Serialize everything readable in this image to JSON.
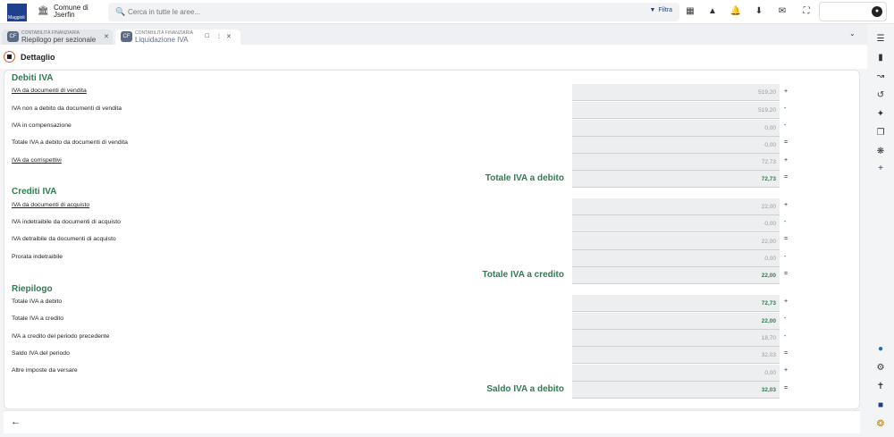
{
  "app": {
    "logo_text": "Maggioli",
    "org_name": "Comune di Jserfin",
    "search_placeholder": "Cerca in tutte le aree...",
    "filter_label": "Filtra",
    "topbar_icons": [
      "apps-icon",
      "alert-icon",
      "bell-icon",
      "download-icon",
      "mail-icon",
      "fullscreen-icon"
    ]
  },
  "tabs": [
    {
      "category": "CONTABILITÀ FINANZIARIA",
      "title": "Riepilogo per sezionale",
      "icon": "CF"
    },
    {
      "category": "CONTABILITÀ FINANZIARIA",
      "title": "Liquidazione IVA",
      "icon": "CF"
    }
  ],
  "header": {
    "title": "Dettaglio"
  },
  "debiti": {
    "title": "Debiti IVA",
    "rows": [
      {
        "label": "IVA da documenti di vendita",
        "value": "519,20",
        "op": "+"
      },
      {
        "label": "IVA non a debito da documenti di vendita",
        "value": "519,20",
        "op": "-"
      },
      {
        "label": "IVA in compensazione",
        "value": "0,00",
        "op": "-"
      },
      {
        "label": "Totale IVA a debito da documenti di vendita",
        "value": "0,00",
        "op": "="
      },
      {
        "label": "IVA da corrispettivi",
        "value": "72,73",
        "op": "+"
      }
    ],
    "total_label": "Totale IVA a debito",
    "total_value": "72,73",
    "total_op": "="
  },
  "crediti": {
    "title": "Crediti IVA",
    "rows": [
      {
        "label": "IVA da documenti di acquisto",
        "value": "22,00",
        "op": "+"
      },
      {
        "label": "IVA indetraibile da documenti di acquisto",
        "value": "0,00",
        "op": "-"
      },
      {
        "label": "IVA detraibile da documenti di acquisto",
        "value": "22,00",
        "op": "="
      },
      {
        "label": "Prorata indetraibile",
        "value": "0,00",
        "op": "-"
      }
    ],
    "total_label": "Totale IVA a credito",
    "total_value": "22,00",
    "total_op": "="
  },
  "riepilogo": {
    "title": "Riepilogo",
    "rows": [
      {
        "label": "Totale IVA a debito",
        "value": "72,73",
        "op": "+"
      },
      {
        "label": "Totale IVA a credito",
        "value": "22,00",
        "op": "-"
      },
      {
        "label": "IVA a credito del periodo precedente",
        "value": "18,70",
        "op": "-"
      },
      {
        "label": "Saldo IVA del periodo",
        "value": "32,03",
        "op": "="
      },
      {
        "label": "Altre imposte da versare",
        "value": "0,00",
        "op": "+"
      }
    ],
    "total_label": "Saldo IVA a debito",
    "total_value": "32,03",
    "total_op": "="
  },
  "colors": {
    "accent_green": "#2e7d4f",
    "brand_blue": "#1f3f8f",
    "field_bg": "#eceeef"
  }
}
